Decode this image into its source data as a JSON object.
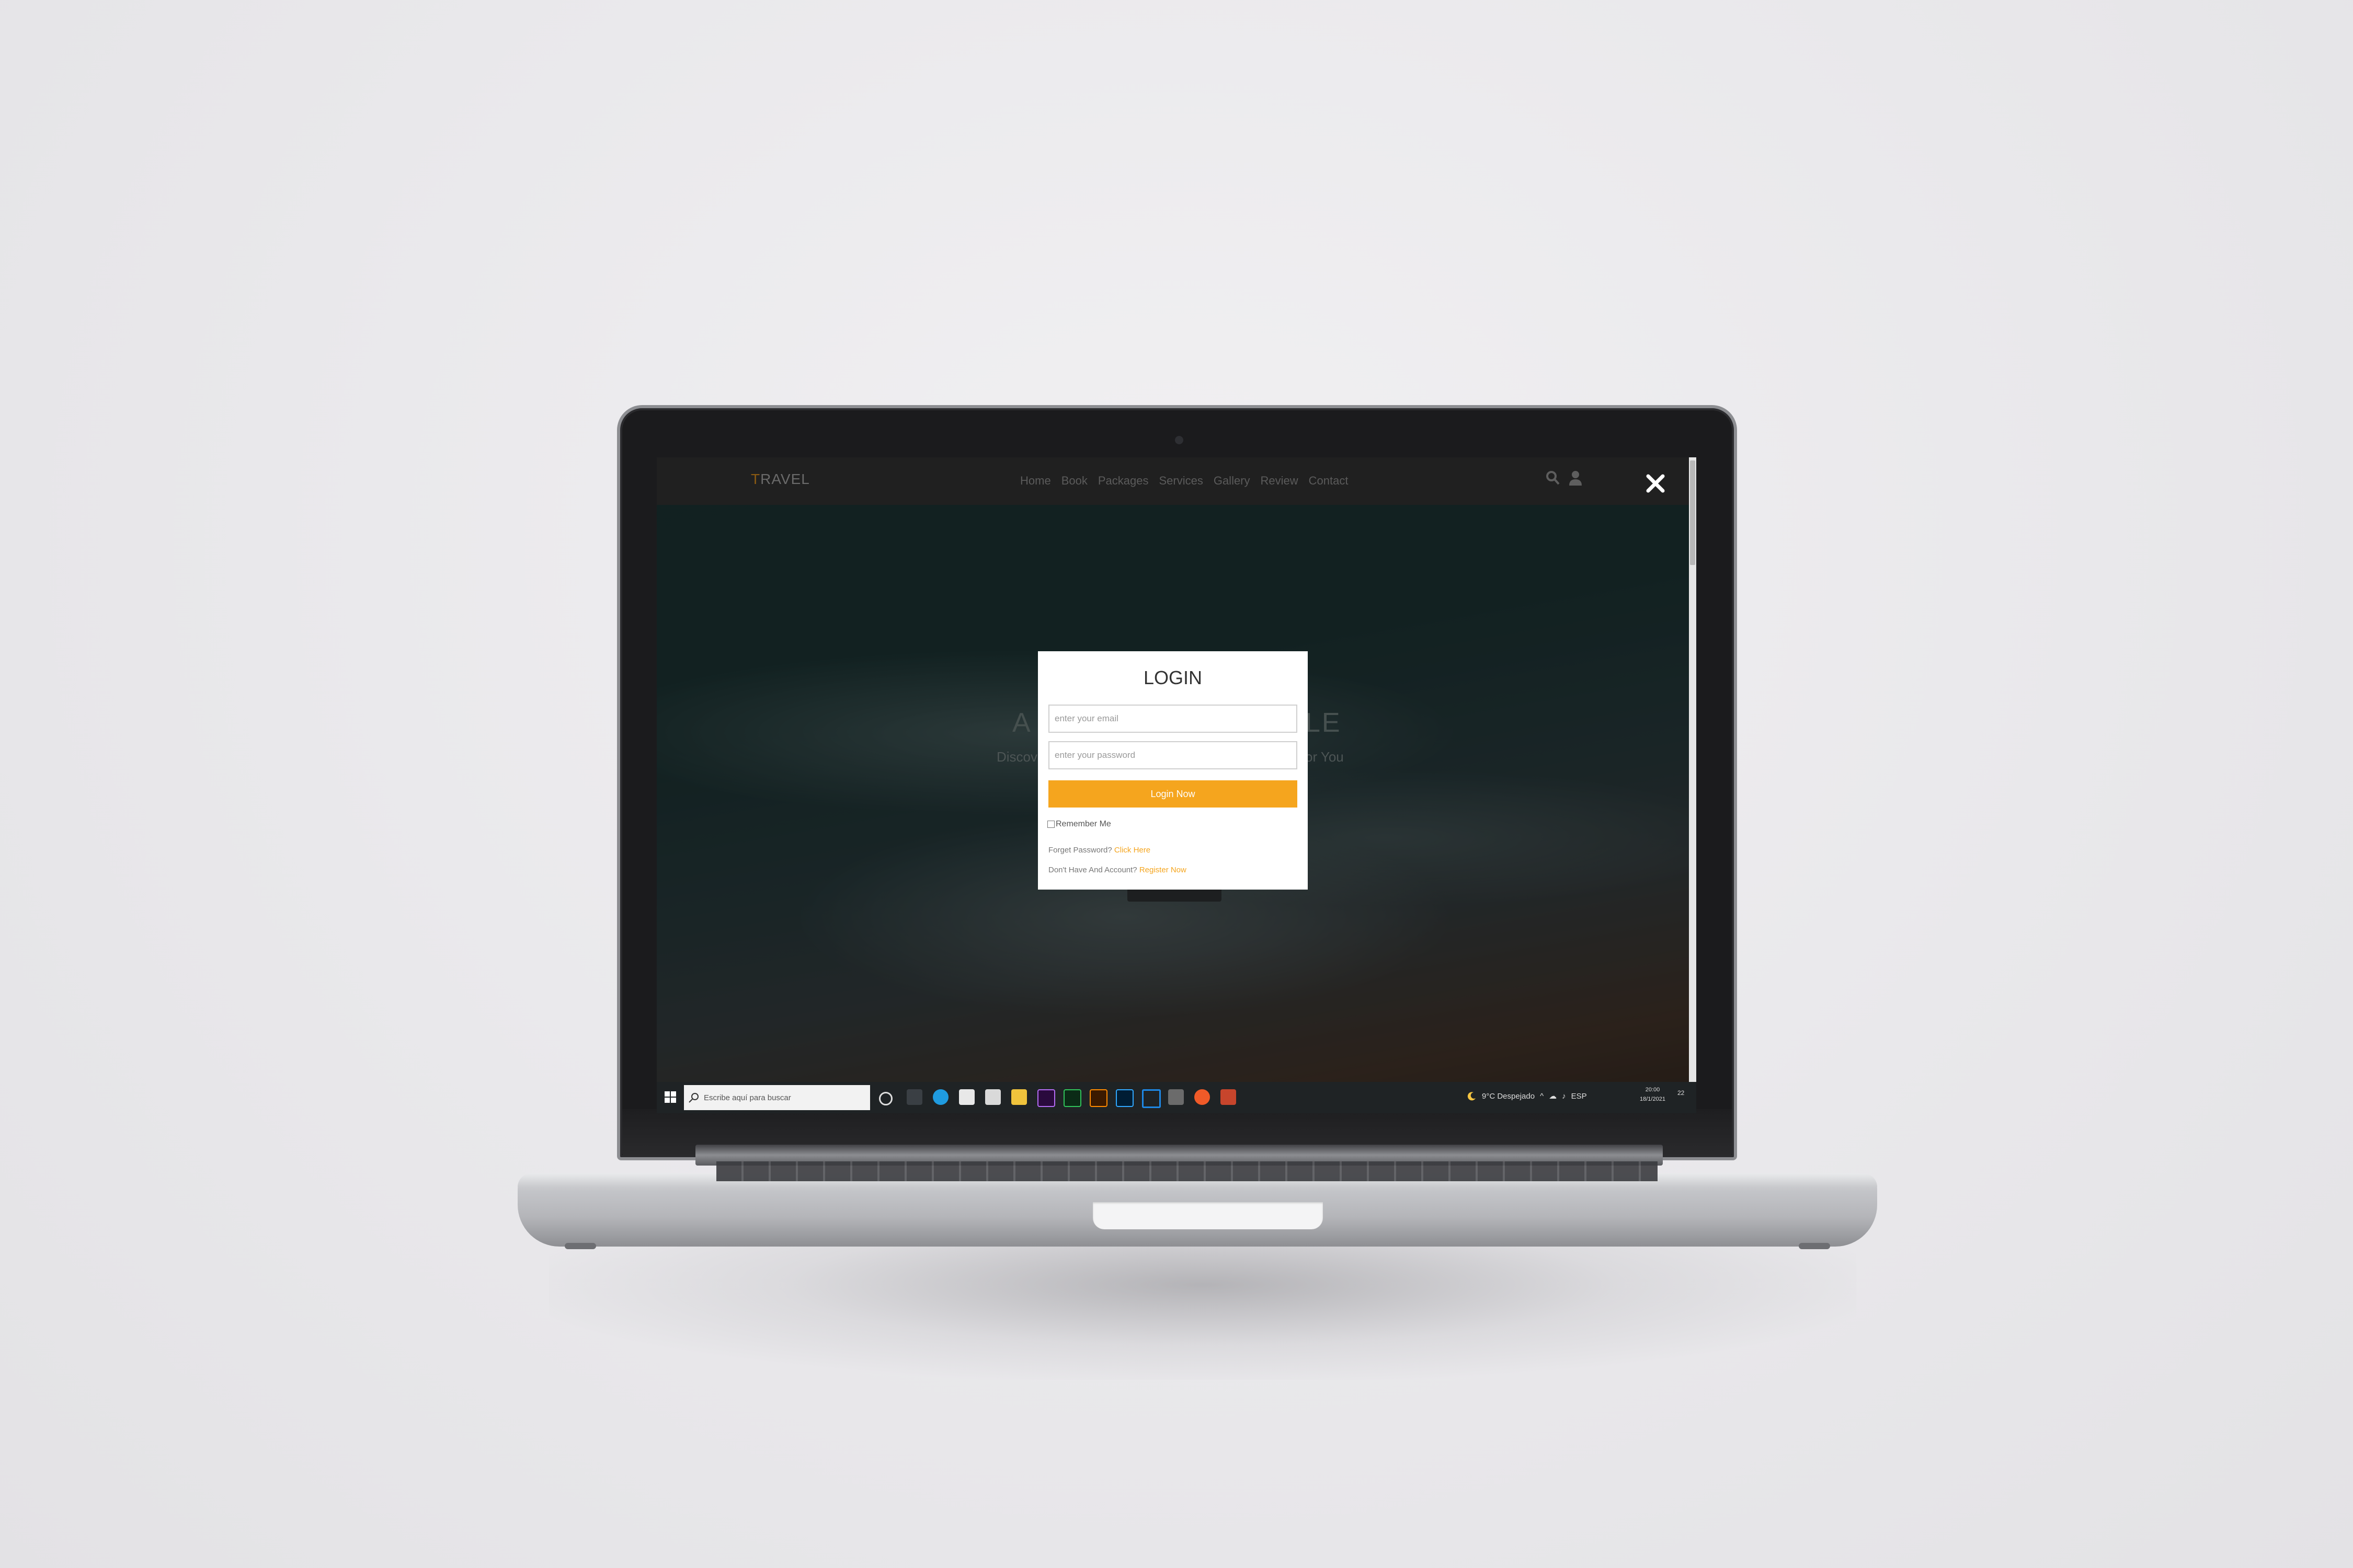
{
  "site": {
    "logo_first": "T",
    "logo_rest": "RAVEL",
    "nav": [
      "Home",
      "Book",
      "Packages",
      "Services",
      "Gallery",
      "Review",
      "Contact"
    ],
    "hero_title_left": "A",
    "hero_title_right": "LE",
    "hero_sub_left": "Discov",
    "hero_sub_right": "or You"
  },
  "login": {
    "title": "LOGIN",
    "email_placeholder": "enter your email",
    "password_placeholder": "enter your password",
    "button": "Login Now",
    "remember": "Remember Me",
    "forgot_text": "Forget Password?",
    "forgot_link": "Click Here",
    "register_text": "Don't Have And Account?",
    "register_link": "Register Now"
  },
  "taskbar": {
    "search_placeholder": "Escribe aquí para buscar",
    "weather": "9°C Despejado",
    "language": "ESP",
    "time": "20:00",
    "date": "18/1/2021",
    "notification_count": "22"
  },
  "colors": {
    "accent": "#f5a51e",
    "navbar": "#202020",
    "taskbar": "#1f2325"
  }
}
